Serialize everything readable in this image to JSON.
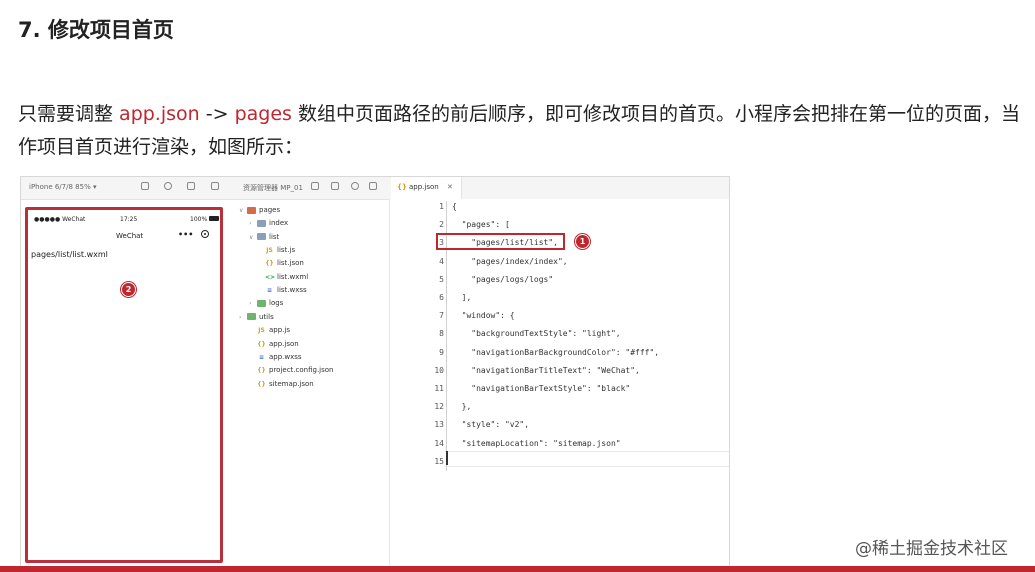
{
  "heading": "7. 修改项目首页",
  "paragraph": {
    "part1": "只需要调整 ",
    "hl1": "app.json",
    "part2": " -> ",
    "hl2": "pages",
    "part3": " 数组中页面路径的前后顺序，即可修改项目的首页。小程序会把排在第一位的页面，当作项目首页进行渲染，如图所示："
  },
  "toolbar": {
    "device": "iPhone 6/7/8 85% ▾",
    "explorer": "资源管理器 MP_01",
    "tab_label": "app.json",
    "tab_close": "✕"
  },
  "phone": {
    "signal": "●●●●● WeChat",
    "time": "17:25",
    "battery": "100%",
    "nav_title": "WeChat",
    "menu_dots": "•••",
    "page_text": "pages/list/list.wxml"
  },
  "tree": [
    {
      "label": "pages",
      "chev": "∨",
      "kind": "folder",
      "color": "red"
    },
    {
      "label": "index",
      "chev": "›",
      "kind": "folder",
      "color": "grey"
    },
    {
      "label": "list",
      "chev": "∨",
      "kind": "folder",
      "color": "grey"
    },
    {
      "label": "list.js",
      "kind": "file",
      "glyph": "JS",
      "color": "#d4a017"
    },
    {
      "label": "list.json",
      "kind": "file",
      "glyph": "{}",
      "color": "#d4a017"
    },
    {
      "label": "list.wxml",
      "kind": "file",
      "glyph": "<>",
      "color": "#2f9e44"
    },
    {
      "label": "list.wxss",
      "kind": "file",
      "glyph": "≡",
      "color": "#3b6fd1"
    },
    {
      "label": "logs",
      "chev": "›",
      "kind": "folder",
      "color": "green"
    },
    {
      "label": "utils",
      "chev": "›",
      "kind": "folder",
      "color": "green"
    },
    {
      "label": "app.js",
      "kind": "file",
      "glyph": "JS",
      "color": "#d4a017"
    },
    {
      "label": "app.json",
      "kind": "file",
      "glyph": "{}",
      "color": "#d4a017"
    },
    {
      "label": "app.wxss",
      "kind": "file",
      "glyph": "≡",
      "color": "#3b6fd1"
    },
    {
      "label": "project.config.json",
      "kind": "file",
      "glyph": "{}",
      "color": "#d4a017"
    },
    {
      "label": "sitemap.json",
      "kind": "file",
      "glyph": "{}",
      "color": "#d4a017"
    }
  ],
  "code": [
    "{",
    "  \"pages\": [",
    "    \"pages/list/list\",",
    "    \"pages/index/index\",",
    "    \"pages/logs/logs\"",
    "  ],",
    "  \"window\": {",
    "    \"backgroundTextStyle\": \"light\",",
    "    \"navigationBarBackgroundColor\": \"#fff\",",
    "    \"navigationBarTitleText\": \"WeChat\",",
    "    \"navigationBarTextStyle\": \"black\"",
    "  },",
    "  \"style\": \"v2\",",
    "  \"sitemapLocation\": \"sitemap.json\"",
    ""
  ],
  "line_numbers": [
    "1",
    "2",
    "3",
    "4",
    "5",
    "6",
    "7",
    "8",
    "9",
    "10",
    "11",
    "12",
    "13",
    "14",
    "15"
  ],
  "badges": {
    "one": "1",
    "two": "2"
  },
  "watermark": "@稀土掘金技术社区",
  "colors": {
    "accent": "#c0262e",
    "string": "#a31515"
  }
}
